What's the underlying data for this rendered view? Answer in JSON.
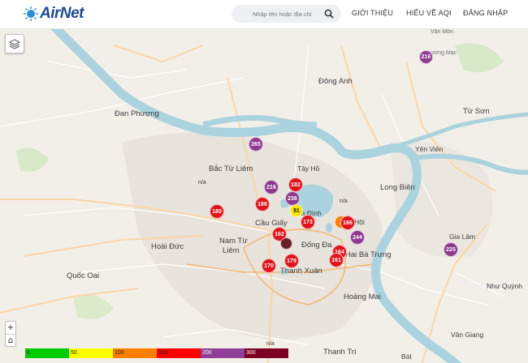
{
  "header": {
    "logo_text": "AirNet",
    "search_placeholder": "Nhập tên hoặc địa chỉ",
    "nav": [
      "GIỚI THIỆU",
      "HIỂU VỀ AQI",
      "ĐĂNG NHẬP"
    ]
  },
  "map_labels": [
    {
      "text": "Vân Môn",
      "size": "small"
    },
    {
      "text": "Đông Anh",
      "size": "big"
    },
    {
      "text": "Đan Phượng",
      "size": "big"
    },
    {
      "text": "Từ Sơn",
      "size": "big"
    },
    {
      "text": "Yên Viên",
      "size": "mid"
    },
    {
      "text": "Bắc Từ Liêm",
      "size": "big"
    },
    {
      "text": "Tây Hồ",
      "size": "mid"
    },
    {
      "text": "Long Biên",
      "size": "big"
    },
    {
      "text": "Ba Đình",
      "size": "mid"
    },
    {
      "text": "Cầu Giấy",
      "size": "big"
    },
    {
      "text": "Hội",
      "size": "mid"
    },
    {
      "text": "Nam Từ",
      "size": "big"
    },
    {
      "text": "Liêm",
      "size": "big"
    },
    {
      "text": "Đống Đa",
      "size": "big"
    },
    {
      "text": "Hai Bà Trưng",
      "size": "big"
    },
    {
      "text": "Hoài Đức",
      "size": "big"
    },
    {
      "text": "Gia Lâm",
      "size": "mid"
    },
    {
      "text": "Quốc Oai",
      "size": "big"
    },
    {
      "text": "Thanh Xuân",
      "size": "big"
    },
    {
      "text": "Hoàng Mai",
      "size": "big"
    },
    {
      "text": "Như Quỳnh",
      "size": "mid"
    },
    {
      "text": "Văn Giang",
      "size": "mid"
    },
    {
      "text": "Thanh Trì",
      "size": "big"
    },
    {
      "text": "Bát",
      "size": "mid"
    },
    {
      "text": "ương Mạc",
      "size": "small"
    }
  ],
  "markers": [
    {
      "value": "216",
      "color": "#8e3a8e"
    },
    {
      "value": "265",
      "color": "#8e3a8e"
    },
    {
      "value": "216",
      "color": "#8e3a8e"
    },
    {
      "value": "182",
      "color": "#e0151b"
    },
    {
      "value": "236",
      "color": "#8e3a8e"
    },
    {
      "value": "186",
      "color": "#e0151b"
    },
    {
      "value": "91",
      "color": "#f7e400"
    },
    {
      "value": "180",
      "color": "#e0151b"
    },
    {
      "value": "173",
      "color": "#e0151b"
    },
    {
      "value": "1",
      "color": "#ff7e00"
    },
    {
      "value": "166",
      "color": "#e0151b"
    },
    {
      "value": "162",
      "color": "#e0151b"
    },
    {
      "value": "244",
      "color": "#8e3a8e"
    },
    {
      "value": "",
      "color": "#6b1f2a"
    },
    {
      "value": "164",
      "color": "#e0151b"
    },
    {
      "value": "161",
      "color": "#e0151b"
    },
    {
      "value": "170",
      "color": "#e0151b"
    },
    {
      "value": "179",
      "color": "#e0151b"
    },
    {
      "value": "225",
      "color": "#8e3a8e"
    }
  ],
  "na_labels": [
    "n/a",
    "n/a",
    "n/a"
  ],
  "zoom": {
    "in": "+",
    "home": "⌂"
  },
  "legend": [
    {
      "label": "0",
      "color": "#00cc00"
    },
    {
      "label": "50",
      "color": "#ffff00"
    },
    {
      "label": "100",
      "color": "#ff7e00"
    },
    {
      "label": "150",
      "color": "#ff0000"
    },
    {
      "label": "200",
      "color": "#8f3f97"
    },
    {
      "label": "300",
      "color": "#7e0023"
    }
  ],
  "colors": {
    "header_bg": "#ffffff",
    "logo": "#1d4b8f",
    "river": "#aad3df",
    "map_bg": "#f2efe9"
  }
}
